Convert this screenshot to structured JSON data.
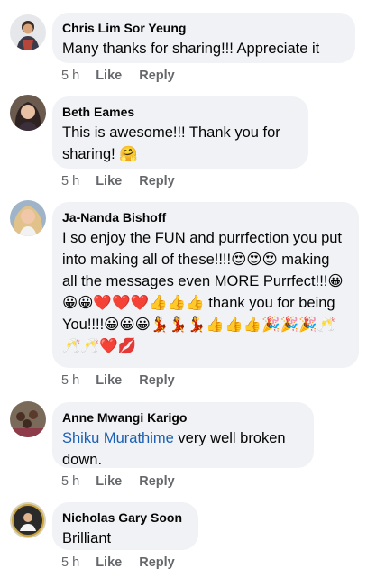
{
  "comments": [
    {
      "author": "Chris Lim Sor Yeung",
      "text": "Many thanks for sharing!!! Appreciate it",
      "time": "5 h",
      "like": "Like",
      "reply": "Reply"
    },
    {
      "author": "Beth Eames",
      "text": "This is awesome!!! Thank you for sharing! 🤗",
      "time": "5 h",
      "like": "Like",
      "reply": "Reply"
    },
    {
      "author": "Ja-Nanda Bishoff",
      "text": "I so enjoy the FUN and purrfection you put into making all of these!!!!😍😍😍 making all the messages even MORE Purrfect!!!😀😀😀❤️❤️❤️👍👍👍 thank you for being You!!!!😀😀😀💃💃💃👍👍👍🎉🎉🎉🥂🥂🥂❤️💋",
      "time": "5 h",
      "like": "Like",
      "reply": "Reply"
    },
    {
      "author": "Anne Mwangi Karigo",
      "mention": "Shiku Murathime",
      "text": " very well broken down.",
      "time": "5 h",
      "like": "Like",
      "reply": "Reply"
    },
    {
      "author": "Nicholas Gary Soon",
      "text": "Brilliant",
      "time": "5 h",
      "like": "Like",
      "reply": "Reply"
    }
  ]
}
